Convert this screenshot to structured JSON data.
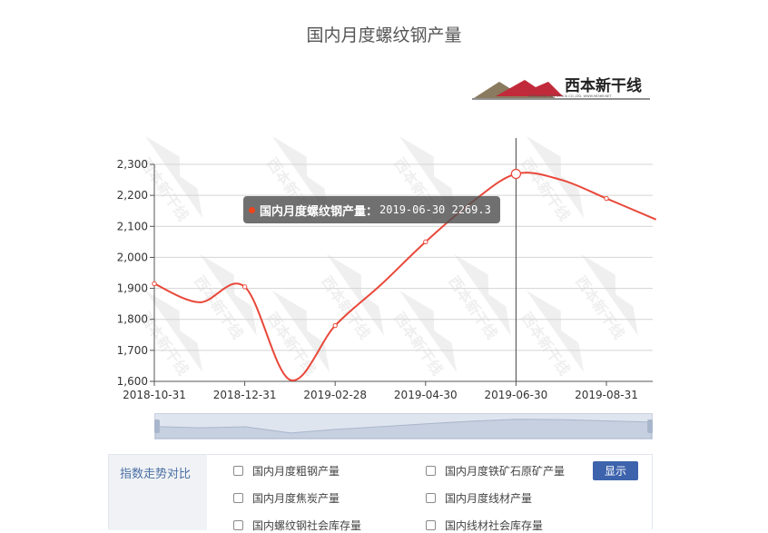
{
  "page": {
    "title": "国内月度螺纹钢产量"
  },
  "logo": {
    "text": "西本新干线",
    "subtext": "XIBEN NEW LINE STOCK CO.,LTD.  WWW.96369.NET"
  },
  "tooltip": {
    "series": "国内月度螺纹钢产量：",
    "value": "2019-06-30  2269.3",
    "marker_color": "#f0441c"
  },
  "chart_data": {
    "type": "line",
    "title": "国内月度螺纹钢产量",
    "xlabel": "",
    "ylabel": "",
    "x": [
      "2018-10-31",
      "2018-11-30",
      "2018-12-31",
      "2019-01-31",
      "2019-02-28",
      "2019-03-31",
      "2019-04-30",
      "2019-05-31",
      "2019-06-30",
      "2019-07-31",
      "2019-08-31",
      "2019-09-30"
    ],
    "series": [
      {
        "name": "国内月度螺纹钢产量",
        "color": "#e8483a",
        "values": [
          1915,
          1855,
          1905,
          1605,
          1780,
          1910,
          2050,
          2175,
          2269.3,
          2250,
          2190,
          2128
        ]
      }
    ],
    "x_tick_labels": [
      "2018-10-31",
      "2018-12-31",
      "2019-02-28",
      "2019-04-30",
      "2019-06-30",
      "2019-08-31"
    ],
    "y_tick_labels": [
      "1,600",
      "1,700",
      "1,800",
      "1,900",
      "2,000",
      "2,100",
      "2,200",
      "2,300"
    ],
    "ylim": [
      1600,
      2300
    ],
    "grid": true,
    "highlighted_point": "2019-06-30"
  },
  "options_panel": {
    "label": "指数走势对比",
    "options": [
      "国内月度粗钢产量",
      "国内月度铁矿石原矿产量",
      "国内月度焦炭产量",
      "国内月度线材产量",
      "国内螺纹钢社会库存量",
      "国内线材社会库存量"
    ],
    "show_button": "显示"
  }
}
